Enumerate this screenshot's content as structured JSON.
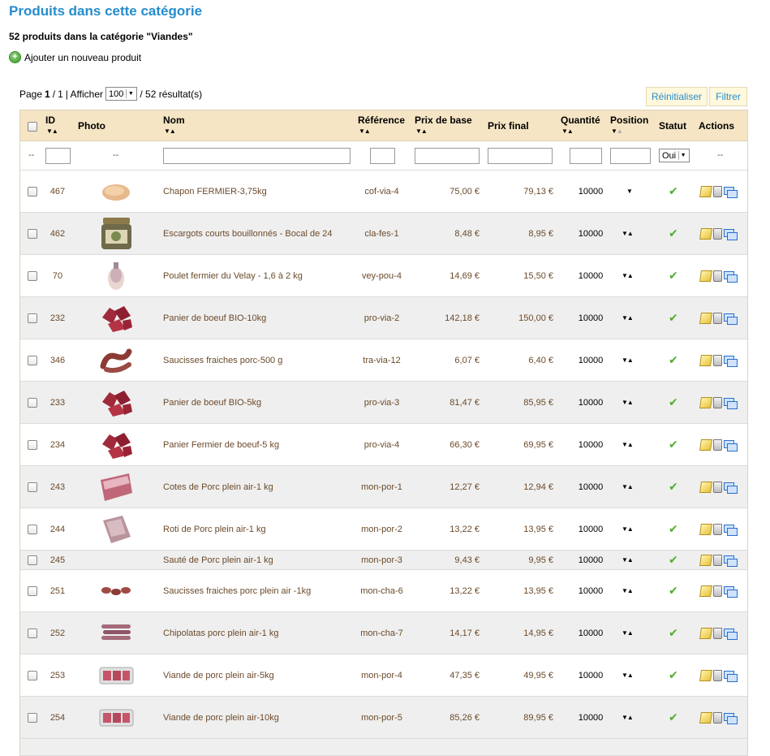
{
  "title": "Produits dans cette catégorie",
  "count_line": "52 produits dans la catégorie \"Viandes\"",
  "add_product": "Ajouter un nouveau produit",
  "pager": {
    "page_prefix": "Page",
    "page_current": "1",
    "page_sep": "/",
    "page_total": "1",
    "show_label": "| Afficher",
    "per_page": "100",
    "results": "/ 52 résultat(s)"
  },
  "buttons": {
    "reset": "Réinitialiser",
    "filter": "Filtrer"
  },
  "columns": {
    "id": "ID",
    "photo": "Photo",
    "name": "Nom",
    "reference": "Référence",
    "base_price": "Prix de base",
    "final_price": "Prix final",
    "quantity": "Quantité",
    "position": "Position",
    "status": "Statut",
    "actions": "Actions"
  },
  "filters": {
    "dash": "--",
    "status_value": "Oui"
  },
  "rows": [
    {
      "id": "467",
      "name": "Chapon FERMIER-3,75kg",
      "ref": "cof-via-4",
      "base": "75,00 €",
      "final": "79,13 €",
      "qty": "10000",
      "thumb": "poultry"
    },
    {
      "id": "462",
      "name": "Escargots courts bouillonnés - Bocal de 24",
      "ref": "cla-fes-1",
      "base": "8,48 €",
      "final": "8,95 €",
      "qty": "10000",
      "thumb": "jar"
    },
    {
      "id": "70",
      "name": "Poulet fermier du Velay - 1,6 à 2 kg",
      "ref": "vey-pou-4",
      "base": "14,69 €",
      "final": "15,50 €",
      "qty": "10000",
      "thumb": "chicken"
    },
    {
      "id": "232",
      "name": "Panier de boeuf BIO-10kg",
      "ref": "pro-via-2",
      "base": "142,18 €",
      "final": "150,00 €",
      "qty": "10000",
      "thumb": "beef"
    },
    {
      "id": "346",
      "name": "Saucisses fraiches porc-500 g",
      "ref": "tra-via-12",
      "base": "6,07 €",
      "final": "6,40 €",
      "qty": "10000",
      "thumb": "sausage"
    },
    {
      "id": "233",
      "name": "Panier de boeuf BIO-5kg",
      "ref": "pro-via-3",
      "base": "81,47 €",
      "final": "85,95 €",
      "qty": "10000",
      "thumb": "beef"
    },
    {
      "id": "234",
      "name": "Panier Fermier de boeuf-5 kg",
      "ref": "pro-via-4",
      "base": "66,30 €",
      "final": "69,95 €",
      "qty": "10000",
      "thumb": "beef"
    },
    {
      "id": "243",
      "name": "Cotes de Porc plein air-1 kg",
      "ref": "mon-por-1",
      "base": "12,27 €",
      "final": "12,94 €",
      "qty": "10000",
      "thumb": "pork"
    },
    {
      "id": "244",
      "name": "Roti de Porc plein air-1 kg",
      "ref": "mon-por-2",
      "base": "13,22 €",
      "final": "13,95 €",
      "qty": "10000",
      "thumb": "roast"
    },
    {
      "id": "245",
      "name": "Sauté de Porc plein air-1 kg",
      "ref": "mon-por-3",
      "base": "9,43 €",
      "final": "9,95 €",
      "qty": "10000",
      "thumb": "none"
    },
    {
      "id": "251",
      "name": "Saucisses fraiches porc plein air -1kg",
      "ref": "mon-cha-6",
      "base": "13,22 €",
      "final": "13,95 €",
      "qty": "10000",
      "thumb": "links"
    },
    {
      "id": "252",
      "name": "Chipolatas porc plein air-1 kg",
      "ref": "mon-cha-7",
      "base": "14,17 €",
      "final": "14,95 €",
      "qty": "10000",
      "thumb": "chipo"
    },
    {
      "id": "253",
      "name": "Viande de porc plein air-5kg",
      "ref": "mon-por-4",
      "base": "47,35 €",
      "final": "49,95 €",
      "qty": "10000",
      "thumb": "tray"
    },
    {
      "id": "254",
      "name": "Viande de porc plein air-10kg",
      "ref": "mon-por-5",
      "base": "85,26 €",
      "final": "89,95 €",
      "qty": "10000",
      "thumb": "tray"
    }
  ],
  "colors": {
    "title": "#268ccd",
    "header_bg": "#f5e5c4",
    "link": "#6b4a2a",
    "ok": "#4fae2b"
  }
}
